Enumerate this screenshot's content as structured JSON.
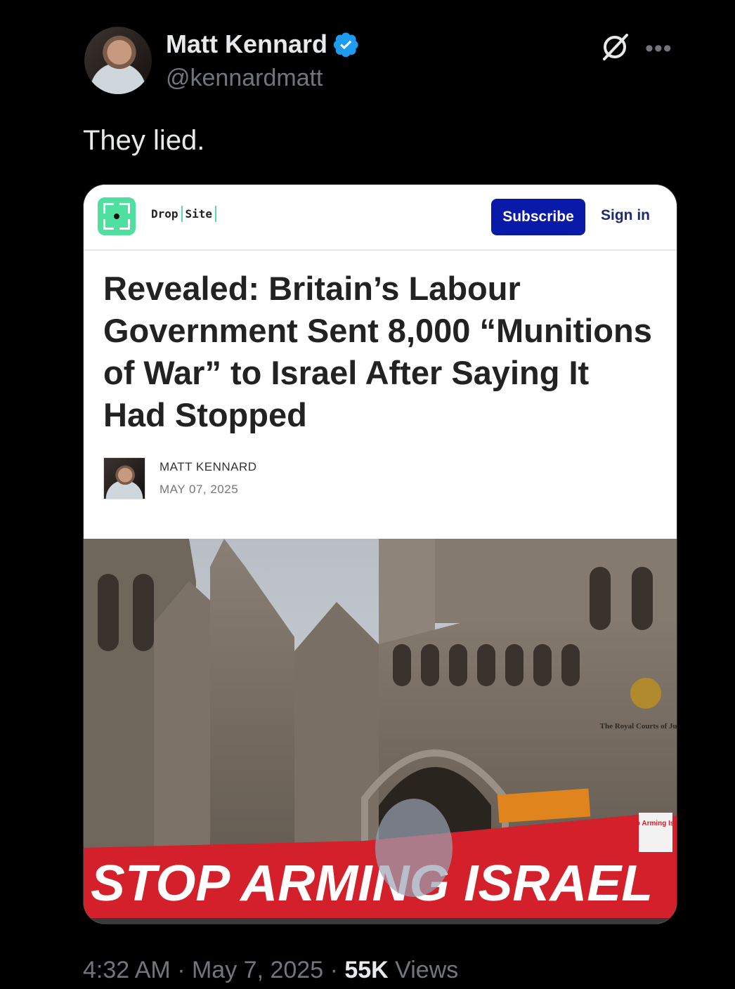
{
  "author": {
    "name": "Matt Kennard",
    "handle": "@kennardmatt"
  },
  "tweet": {
    "text": "They lied.",
    "time": "4:32 AM",
    "date": "May 7, 2025",
    "separator": "·",
    "views_count": "55K",
    "views_label": "Views"
  },
  "icons": {
    "verified": "verified-badge-icon",
    "grok": "grok-icon",
    "more": "more-icon"
  },
  "card": {
    "site_name_left": "Drop",
    "site_name_right": "Site",
    "subscribe_label": "Subscribe",
    "signin_label": "Sign in",
    "headline": "Revealed: Britain’s Labour Government Sent 8,000 “Munitions of War” to Israel After Saying It Had Stopped",
    "author_name": "MATT KENNARD",
    "date": "MAY 07, 2025",
    "photo": {
      "banner_text": "STOP ARMING ISRAEL",
      "sign_text": "Stop Arming Israel",
      "building_sign": "The Royal Courts of Justice"
    }
  },
  "colors": {
    "background": "#000000",
    "text_primary": "#e7e9ea",
    "text_secondary": "#71767b",
    "verified_blue": "#1d9bf0",
    "subscribe_blue": "#0a1aa8",
    "drop_site_green": "#4fe0a0",
    "banner_red": "#d4202a"
  }
}
